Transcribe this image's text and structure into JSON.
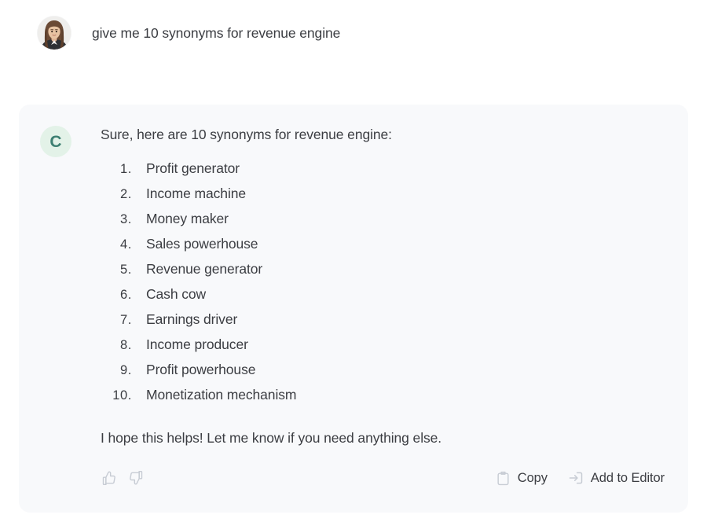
{
  "user_message": {
    "avatar_icon": "user-photo-avatar",
    "text": "give me 10 synonyms for revenue engine"
  },
  "assistant_message": {
    "avatar_letter": "C",
    "avatar_bg_color": "#e3f2e8",
    "avatar_text_color": "#3d7f72",
    "card_bg_color": "#f8f9fb",
    "intro": "Sure, here are 10 synonyms for revenue engine:",
    "list": [
      {
        "num": "1.",
        "label": "Profit generator"
      },
      {
        "num": "2.",
        "label": "Income machine"
      },
      {
        "num": "3.",
        "label": "Money maker"
      },
      {
        "num": "4.",
        "label": "Sales powerhouse"
      },
      {
        "num": "5.",
        "label": "Revenue generator"
      },
      {
        "num": "6.",
        "label": "Cash cow"
      },
      {
        "num": "7.",
        "label": "Earnings driver"
      },
      {
        "num": "8.",
        "label": "Income producer"
      },
      {
        "num": "9.",
        "label": "Profit powerhouse"
      },
      {
        "num": "10.",
        "label": "Monetization mechanism"
      }
    ],
    "outro": "I hope this helps! Let me know if you need anything else.",
    "footer": {
      "thumbs_up_icon": "thumbs-up-icon",
      "thumbs_down_icon": "thumbs-down-icon",
      "copy_icon": "clipboard-icon",
      "copy_label": "Copy",
      "add_to_editor_icon": "arrow-into-box-icon",
      "add_to_editor_label": "Add to Editor",
      "icon_color": "#c7ccd4",
      "text_color": "#3b3d42"
    }
  }
}
